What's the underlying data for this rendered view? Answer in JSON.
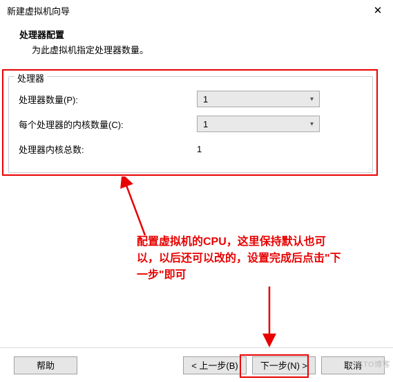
{
  "window": {
    "title": "新建虚拟机向导",
    "close": "✕"
  },
  "header": {
    "heading": "处理器配置",
    "subheading": "为此虚拟机指定处理器数量。"
  },
  "group": {
    "title": "处理器",
    "rows": {
      "processors_label": "处理器数量(P):",
      "processors_value": "1",
      "cores_label": "每个处理器的内核数量(C):",
      "cores_value": "1",
      "total_label": "处理器内核总数:",
      "total_value": "1"
    }
  },
  "annotation": {
    "text": "配置虚拟机的CPU，这里保持默认也可以，以后还可以改的，设置完成后点击\"下一步\"即可",
    "color": "#e80000"
  },
  "buttons": {
    "help": "帮助",
    "back": "< 上一步(B)",
    "next": "下一步(N) >",
    "cancel": "取消"
  },
  "watermark": "51CTO博客",
  "colors": {
    "highlight": "#e80000"
  }
}
